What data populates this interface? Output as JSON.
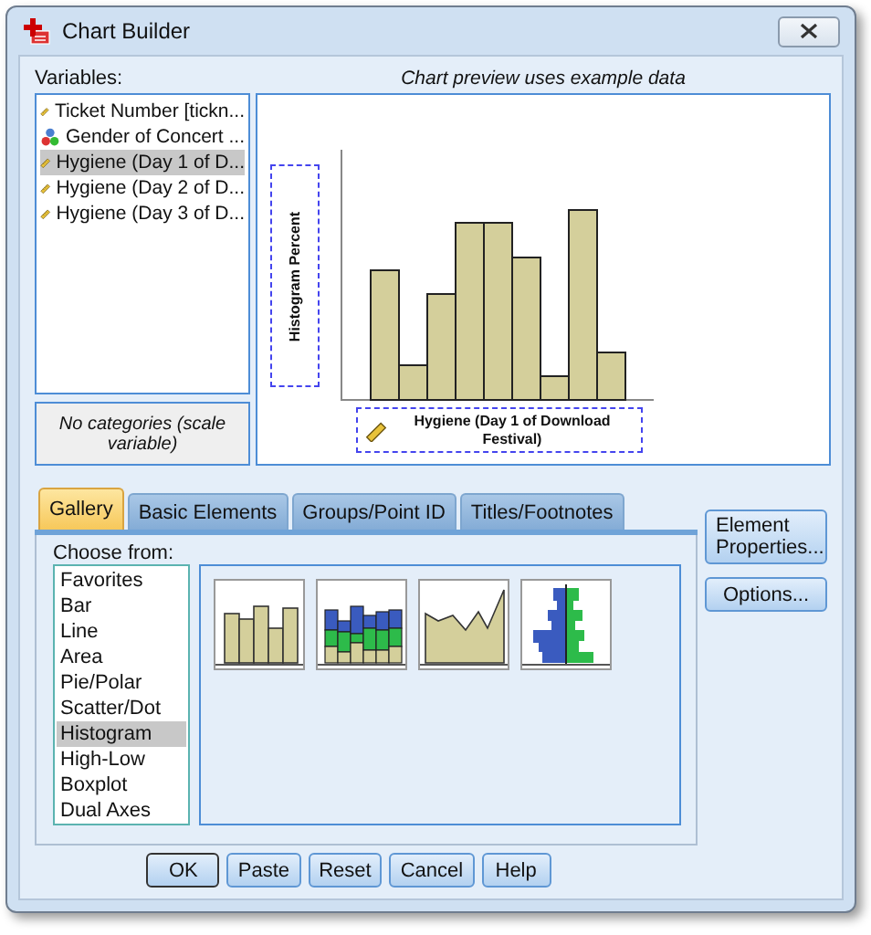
{
  "window": {
    "title": "Chart Builder"
  },
  "variables": {
    "label": "Variables:",
    "items": [
      {
        "name": "Ticket Number [tickn...",
        "kind": "scale",
        "selected": false
      },
      {
        "name": "Gender of Concert ...",
        "kind": "nominal",
        "selected": false
      },
      {
        "name": "Hygiene (Day 1 of D...",
        "kind": "scale",
        "selected": true
      },
      {
        "name": "Hygiene (Day 2 of D...",
        "kind": "scale",
        "selected": false
      },
      {
        "name": "Hygiene (Day 3 of D...",
        "kind": "scale",
        "selected": false
      }
    ]
  },
  "category_note": "No categories (scale variable)",
  "preview": {
    "caption": "Chart preview uses example data",
    "y_drop_zone": "Histogram Percent",
    "x_drop_zone": "Hygiene (Day 1 of Download Festival)"
  },
  "tabs": [
    {
      "label": "Gallery",
      "selected": true
    },
    {
      "label": "Basic Elements",
      "selected": false
    },
    {
      "label": "Groups/Point ID",
      "selected": false
    },
    {
      "label": "Titles/Footnotes",
      "selected": false
    }
  ],
  "gallery": {
    "label": "Choose from:",
    "types": [
      {
        "label": "Favorites",
        "selected": false
      },
      {
        "label": "Bar",
        "selected": false
      },
      {
        "label": "Line",
        "selected": false
      },
      {
        "label": "Area",
        "selected": false
      },
      {
        "label": "Pie/Polar",
        "selected": false
      },
      {
        "label": "Scatter/Dot",
        "selected": false
      },
      {
        "label": "Histogram",
        "selected": true
      },
      {
        "label": "High-Low",
        "selected": false
      },
      {
        "label": "Boxplot",
        "selected": false
      },
      {
        "label": "Dual Axes",
        "selected": false
      }
    ],
    "thumbnails": [
      {
        "kind": "bars"
      },
      {
        "kind": "stacked"
      },
      {
        "kind": "area"
      },
      {
        "kind": "pyramid"
      }
    ]
  },
  "side_buttons": [
    "Element Properties...",
    "Options..."
  ],
  "buttons": [
    {
      "label": "OK",
      "default": true
    },
    {
      "label": "Paste",
      "default": false
    },
    {
      "label": "Reset",
      "default": false
    },
    {
      "label": "Cancel",
      "default": false
    },
    {
      "label": "Help",
      "default": false
    }
  ]
}
